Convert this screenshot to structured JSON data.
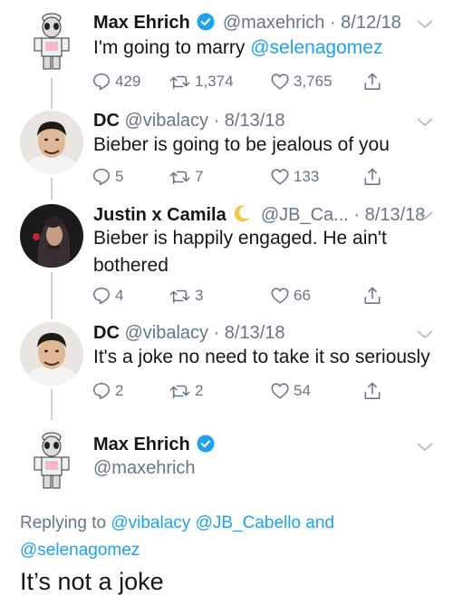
{
  "tweets": [
    {
      "name": "Max Ehrich",
      "handle": "@maxehrich",
      "date": "· 8/12/18",
      "text_prefix": "I'm going to marry ",
      "text_mention": "@selenagomez",
      "replies": "429",
      "retweets": "1,374",
      "likes": "3,765"
    },
    {
      "name": "DC",
      "handle": "@vibalacy",
      "date": "· 8/13/18",
      "text": "Bieber is going to be jealous of you",
      "replies": "5",
      "retweets": "7",
      "likes": "133"
    },
    {
      "name": "Justin x Camila",
      "name_emoji": "moon-emoji",
      "handle": "@JB_Ca...",
      "date": "· 8/13/18",
      "text_line1": "Bieber is happily engaged. He ain't",
      "text_line2": "bothered",
      "replies": "4",
      "retweets": "3",
      "likes": "66"
    },
    {
      "name": "DC",
      "handle": "@vibalacy",
      "date": "· 8/13/18",
      "text": "It's a joke no need to take it so seriously",
      "replies": "2",
      "retweets": "2",
      "likes": "54"
    }
  ],
  "main_tweet": {
    "name": "Max Ehrich",
    "handle": "@maxehrich",
    "replying_prefix": "Replying to ",
    "replying_mention1": "@vibalacy",
    "replying_mention2": "@JB_Cabello",
    "replying_and": " and",
    "replying_mention3": "@selenagomez",
    "text": "It’s not a joke"
  },
  "colors": {
    "accent": "#1da1f2",
    "secondary_text": "#657786",
    "thread_line": "#c8d1d8"
  }
}
